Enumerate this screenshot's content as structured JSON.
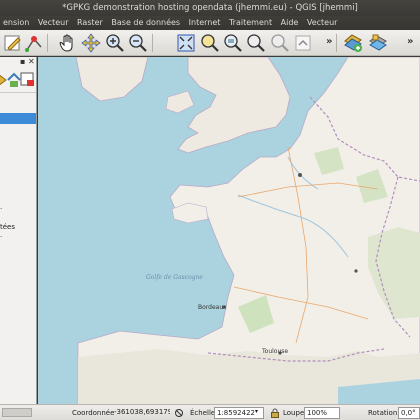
{
  "window": {
    "title": "*GPKG demonstration hosting opendata (jhemmi.eu) - QGIS [jhemmi]"
  },
  "menu": {
    "items": [
      "ension",
      "Vecteur",
      "Raster",
      "Base de données",
      "Internet",
      "Traitement",
      "Aide",
      "Vecteur"
    ]
  },
  "toolbar": {
    "more_glyph": "»"
  },
  "layers_panel": {
    "controls": [
      "▪",
      "✕"
    ],
    "partial_item_label": "tées"
  },
  "map": {
    "labels": {
      "golfe": "Golfe de Gascogne",
      "toulouse": "Toulouse",
      "bordeaux": "Bordeaux"
    }
  },
  "statusbar": {
    "coord_label": "Coordonnée",
    "coord_value": "-361038,6931797",
    "scale_label": "Échelle",
    "scale_value": "1:8592422",
    "magnifier_label": "Loupe",
    "magnifier_value": "100%",
    "rotation_label": "Rotation",
    "rotation_value": "0,0°"
  }
}
